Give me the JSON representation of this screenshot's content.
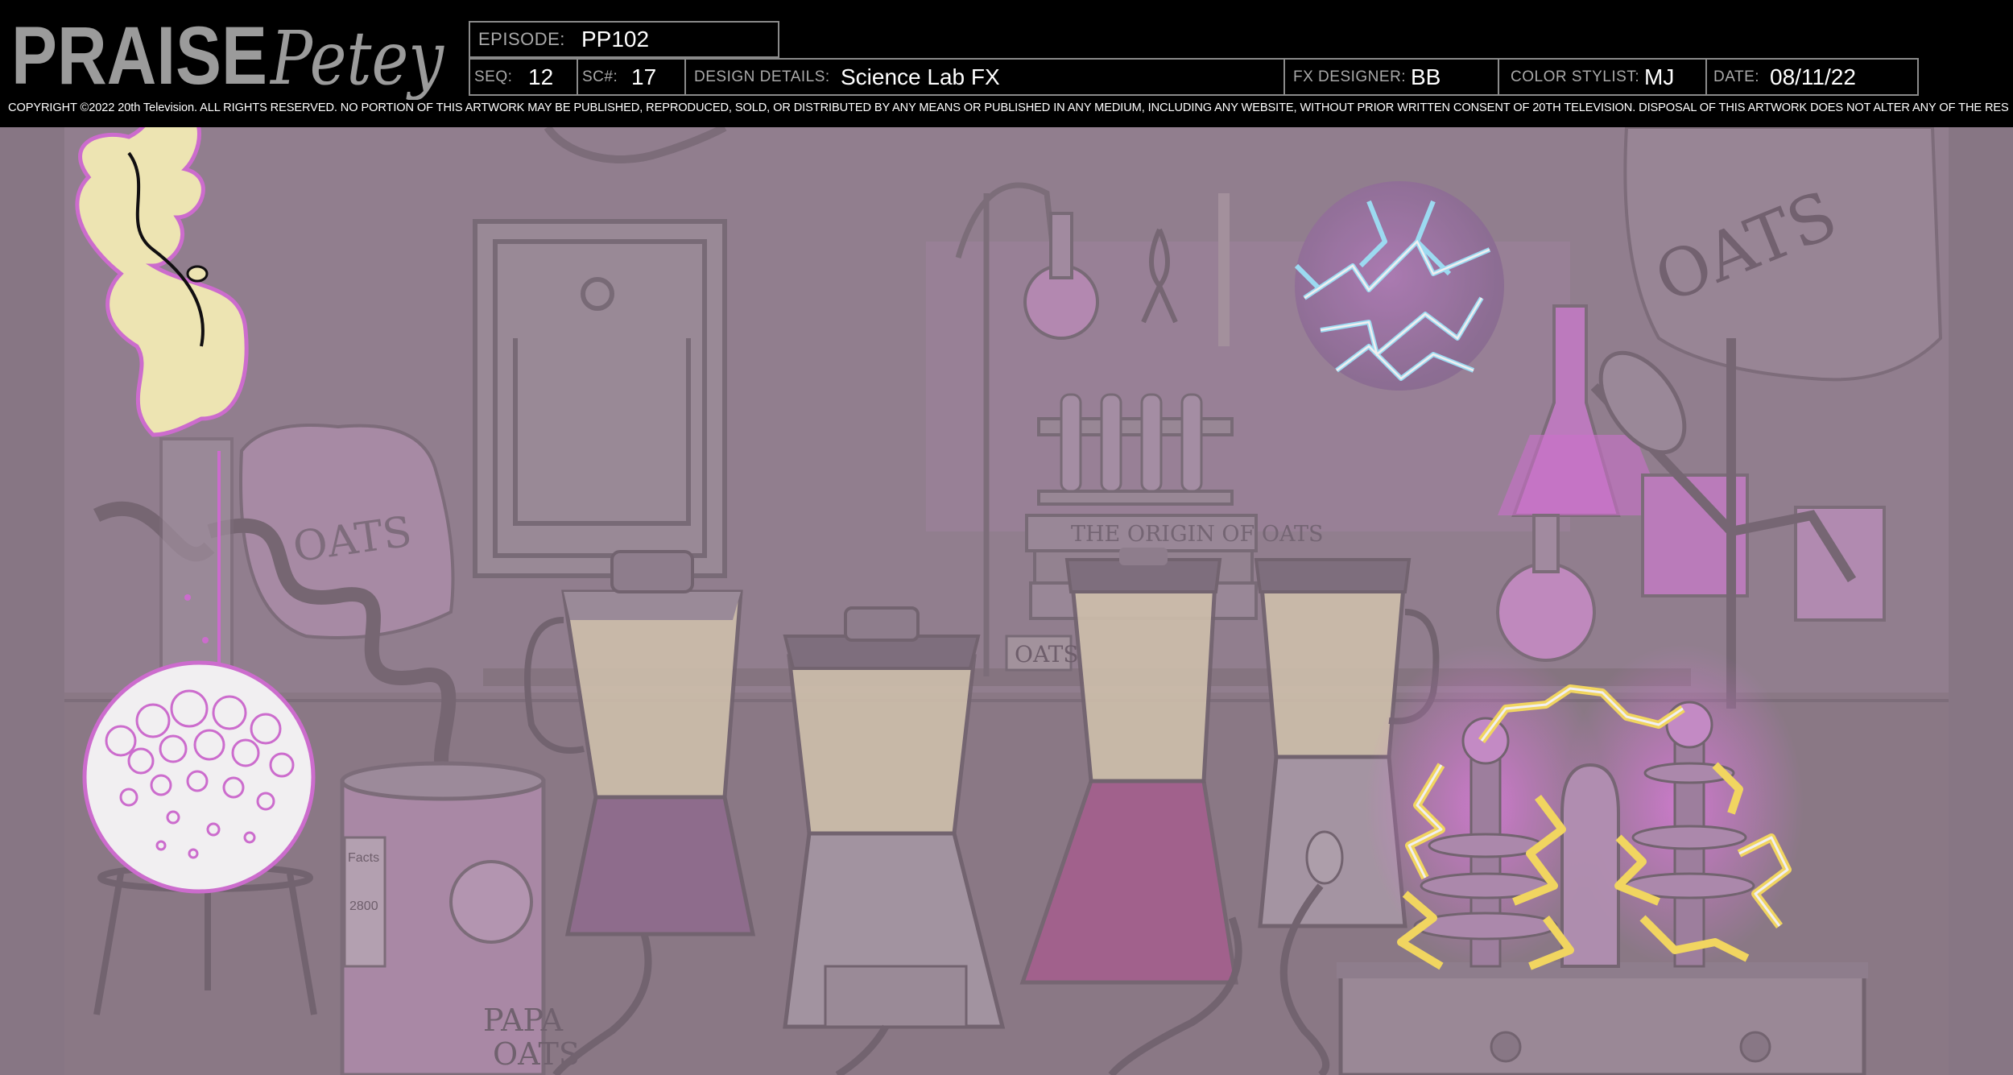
{
  "header": {
    "logo": {
      "word1": "PRAISE",
      "word2": "Petey"
    },
    "episode": {
      "label": "EPISODE:",
      "value": "PP102"
    },
    "seq": {
      "label": "SEQ:",
      "value": "12"
    },
    "scene": {
      "label": "SC#:",
      "value": "17"
    },
    "design_details": {
      "label": "DESIGN DETAILS:",
      "value": "Science Lab FX"
    },
    "fx_designer": {
      "label": "FX DESIGNER:",
      "value": "BB"
    },
    "color_stylist": {
      "label": "COLOR STYLIST:",
      "value": "MJ"
    },
    "date": {
      "label": "DATE:",
      "value": "08/11/22"
    }
  },
  "copyright": "COPYRIGHT ©2022 20th Television. ALL RIGHTS RESERVED. NO PORTION OF THIS ARTWORK MAY BE PUBLISHED, REPRODUCED, SOLD, OR DISTRIBUTED BY ANY MEANS OR PUBLISHED IN ANY MEDIUM, INCLUDING ANY WEBSITE, WITHOUT PRIOR WRITTEN CONSENT OF 20TH TELEVISION. DISPOSAL OF THIS ARTWORK DOES NOT ALTER ANY OF THE RESTRICTIONS SET FORTH ABOVE.",
  "artwork": {
    "labels": {
      "oats_sack_left": "OATS",
      "oats_sack_right": "OATS",
      "book_title": "THE ORIGIN OF OATS",
      "oats_tag": "OATS",
      "can_label_line1": "PAPA",
      "can_label_line2": "OATS",
      "can_facts_title": "Facts",
      "can_facts_line": "2800"
    },
    "colors": {
      "background": "#8c7d89",
      "wall": "#8f7f8c",
      "magenta_glow": "#d56ad6",
      "electric_yellow": "#ffe25a",
      "electric_blue": "#9fe8ff",
      "smoke_cream": "#fbf3b8"
    }
  }
}
